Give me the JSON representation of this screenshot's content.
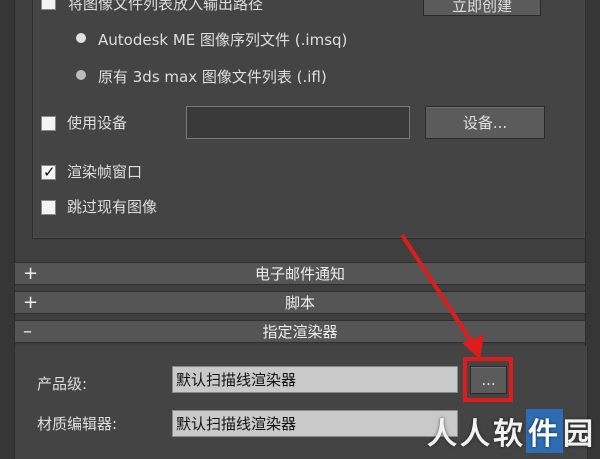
{
  "group": {
    "top_checkbox_label": "将图像文件列表放入输出路径",
    "create_now_button": "立即创建",
    "radio_imsq": "Autodesk ME 图像序列文件 (.imsq)",
    "radio_ifl": "原有 3ds max 图像文件列表 (.ifl)",
    "use_device_label": "使用设备",
    "device_value": "",
    "device_button": "设备...",
    "render_frame_window_label": "渲染帧窗口",
    "skip_existing_label": "跳过现有图像"
  },
  "rollouts": {
    "email": {
      "sign": "+",
      "title": "电子邮件通知"
    },
    "script": {
      "sign": "+",
      "title": "脚本"
    },
    "assign": {
      "sign": "–",
      "title": "指定渲染器"
    }
  },
  "assign_renderer": {
    "production_label": "产品级:",
    "production_value": "默认扫描线渲染器",
    "browse_button": "...",
    "material_editor_label": "材质编辑器:",
    "material_editor_value": "默认扫描线渲染器"
  },
  "watermark": {
    "prefix": "人人软",
    "boxed": "件",
    "suffix": "园"
  },
  "colors": {
    "highlight": "#e01b1b",
    "arrow": "#e01b1b"
  }
}
